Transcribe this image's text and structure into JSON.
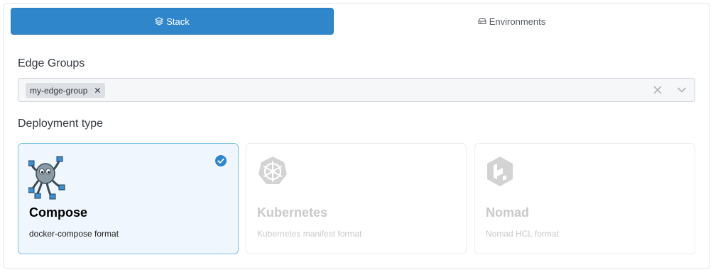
{
  "tabs": [
    {
      "label": "Stack",
      "icon": "layers-icon",
      "active": true
    },
    {
      "label": "Environments",
      "icon": "hard-drive-icon",
      "active": false
    }
  ],
  "edge_groups": {
    "label": "Edge Groups",
    "selected": [
      {
        "label": "my-edge-group"
      }
    ]
  },
  "deployment": {
    "label": "Deployment type",
    "options": [
      {
        "title": "Compose",
        "description": "docker-compose format",
        "selected": true,
        "disabled": false,
        "icon": "docker-compose-octopus-icon"
      },
      {
        "title": "Kubernetes",
        "description": "Kubernetes manifest format",
        "selected": false,
        "disabled": true,
        "icon": "kubernetes-helm-icon"
      },
      {
        "title": "Nomad",
        "description": "Nomad HCL format",
        "selected": false,
        "disabled": true,
        "icon": "nomad-icon"
      }
    ]
  },
  "colors": {
    "primary": "#2f86cb",
    "selected_card_border": "#7ec3e8",
    "selected_card_bg": "#eff6fd",
    "disabled_text": "#c9c9c9"
  }
}
